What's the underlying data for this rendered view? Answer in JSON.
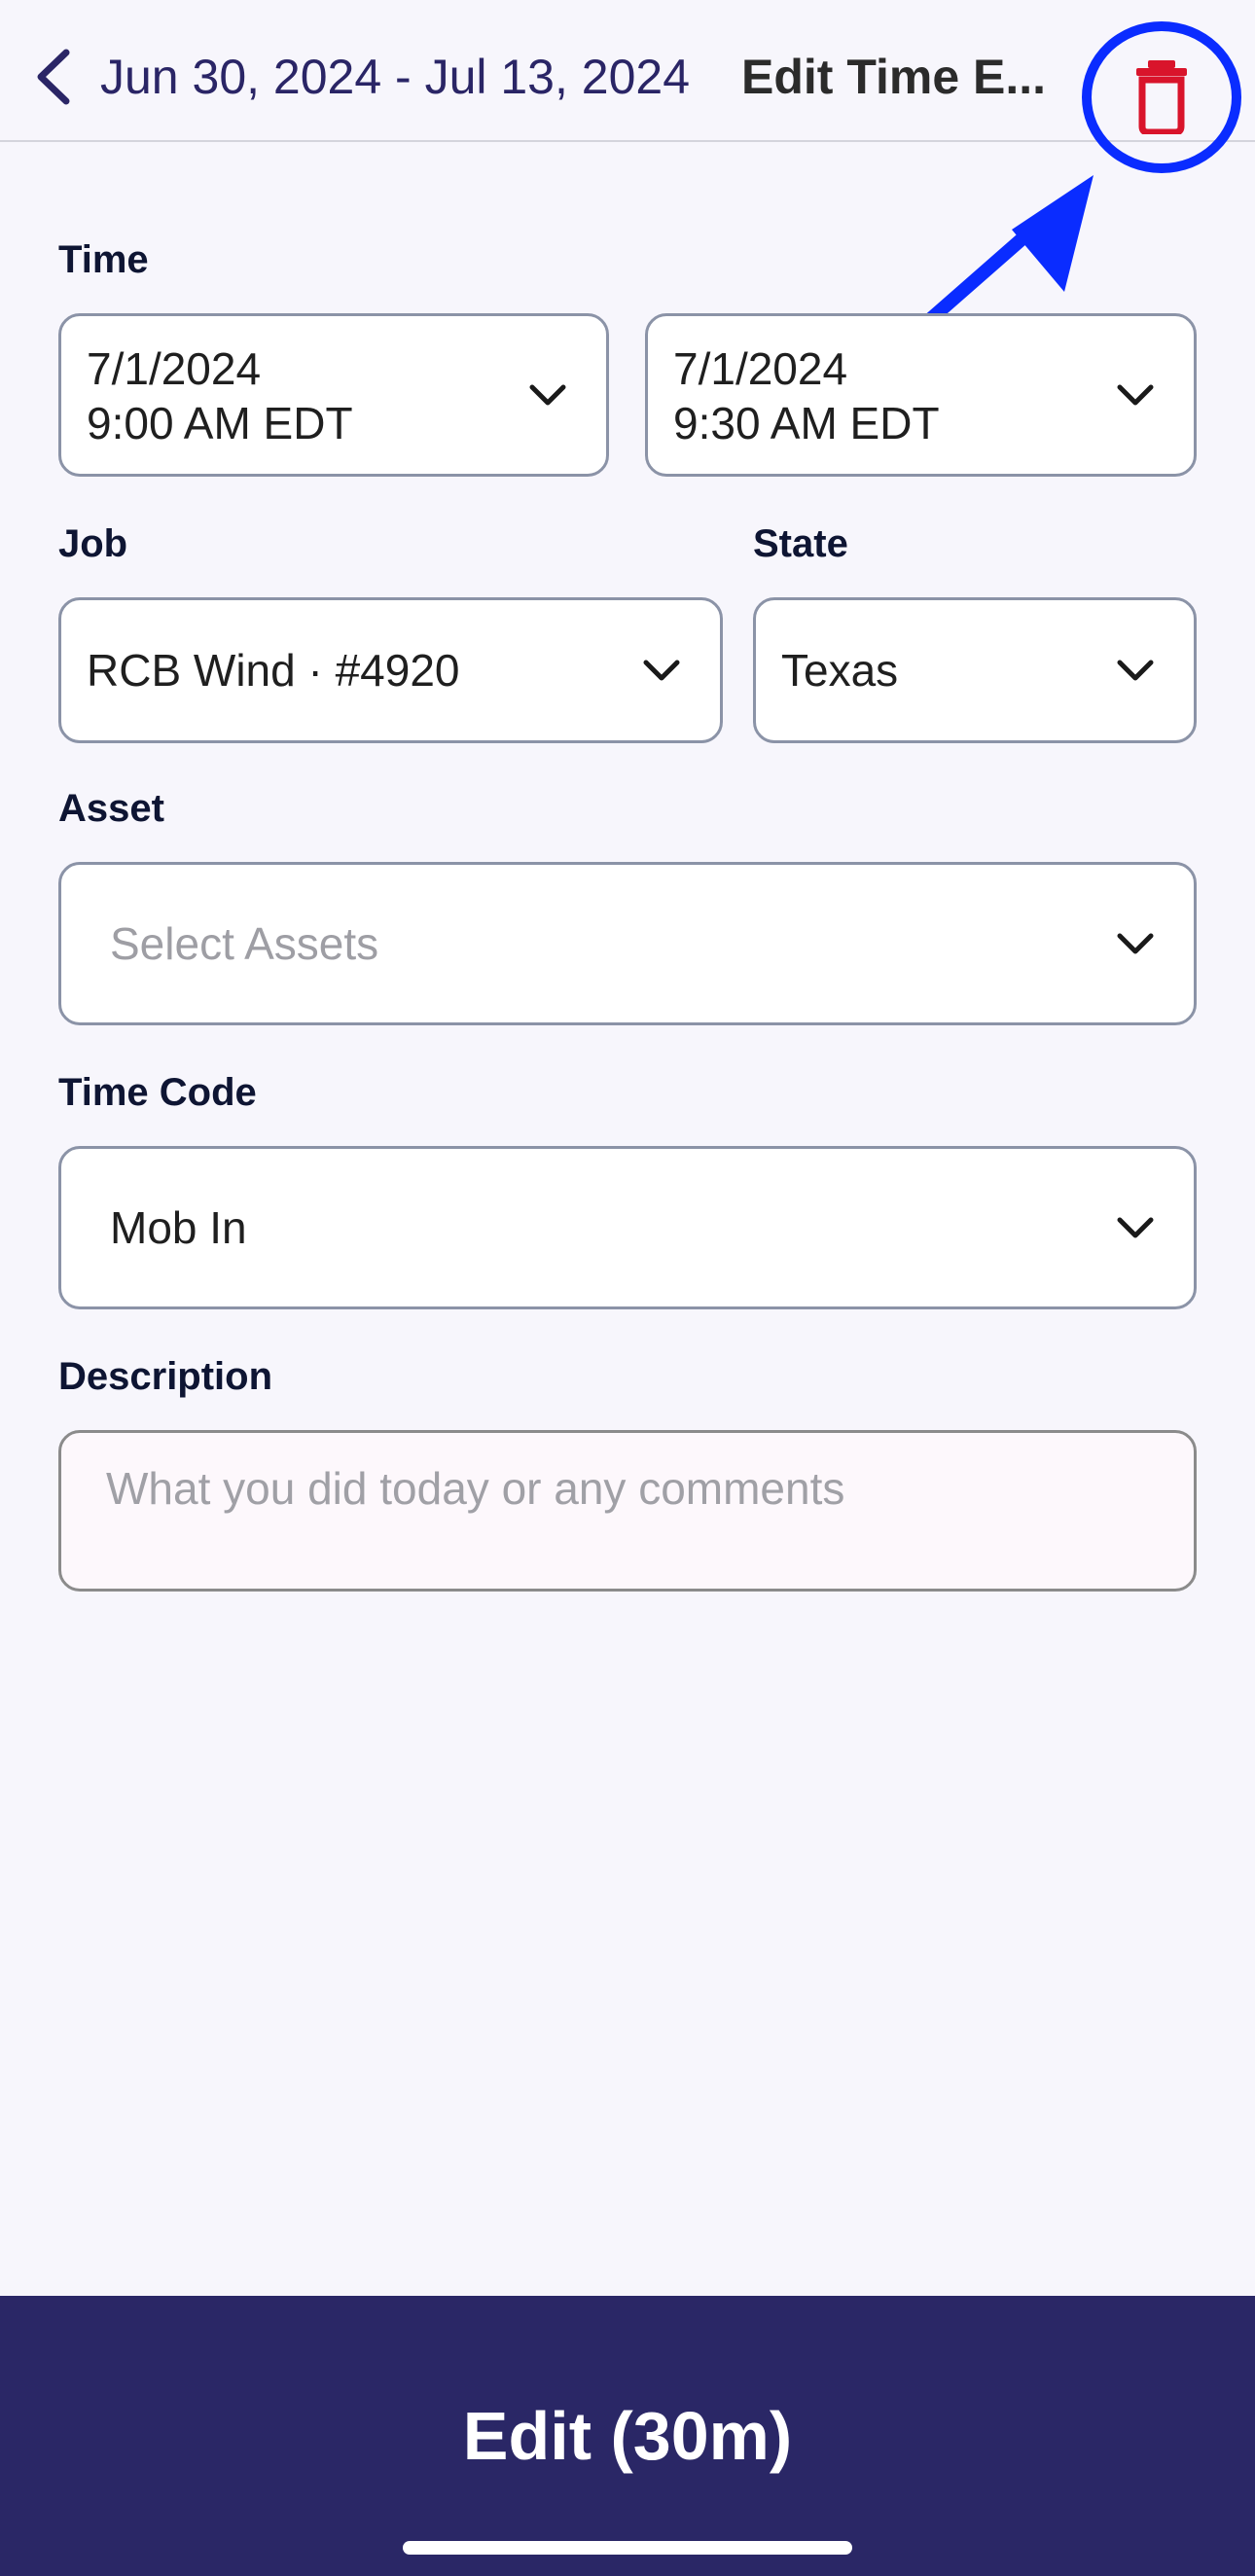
{
  "header": {
    "back_label": "Jun 30, 2024 - Jul 13, 2024",
    "title": "Edit Time E...",
    "back_icon": "chevron-left-icon",
    "delete_icon": "trash-icon",
    "delete_color": "#d9142b",
    "annotation_color": "#0a2cff"
  },
  "time": {
    "label": "Time",
    "start": {
      "date": "7/1/2024",
      "time": "9:00 AM EDT"
    },
    "end": {
      "date": "7/1/2024",
      "time": "9:30 AM EDT"
    }
  },
  "job": {
    "label": "Job",
    "value": "RCB Wind · #4920"
  },
  "state": {
    "label": "State",
    "value": "Texas"
  },
  "asset": {
    "label": "Asset",
    "placeholder": "Select Assets"
  },
  "time_code": {
    "label": "Time Code",
    "value": "Mob In"
  },
  "description": {
    "label": "Description",
    "placeholder": "What you did today or any comments"
  },
  "footer": {
    "button_label": "Edit (30m)",
    "background": "#2a2766"
  }
}
